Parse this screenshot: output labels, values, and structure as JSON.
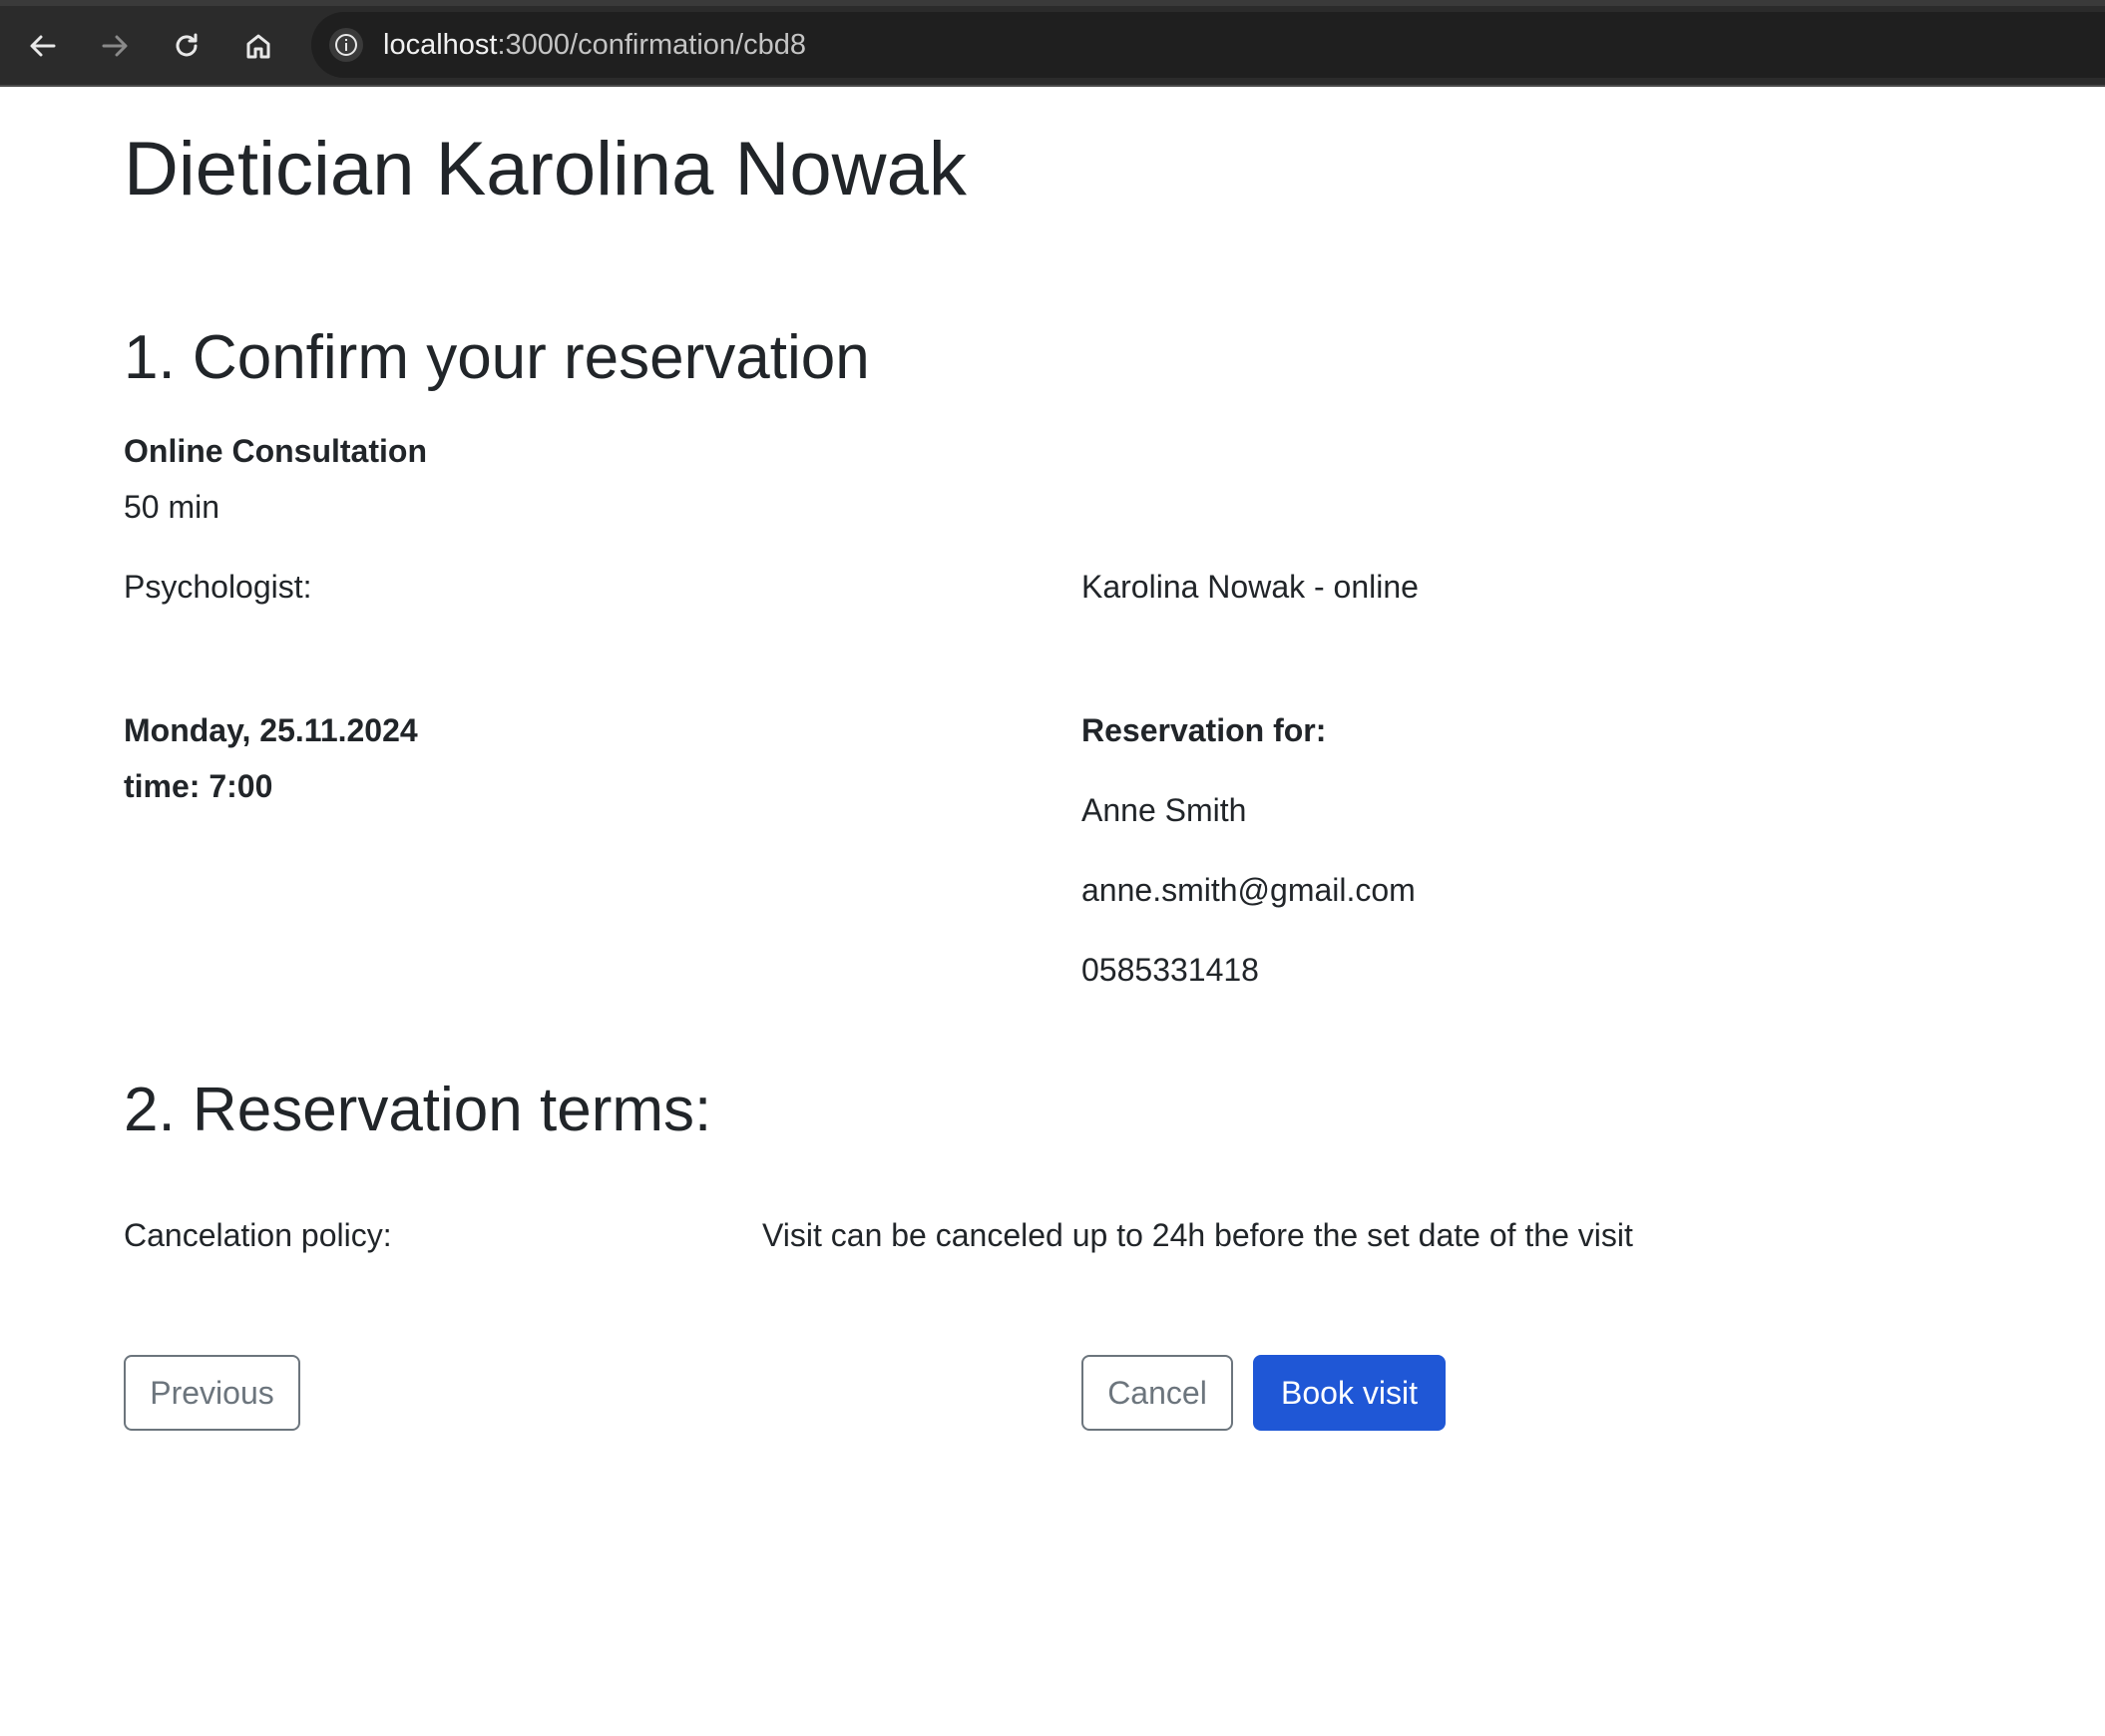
{
  "browser": {
    "url_host": "localhost",
    "url_path": ":3000/confirmation/cbd8",
    "icons": [
      "back-arrow-icon",
      "forward-arrow-icon",
      "reload-icon",
      "home-icon",
      "info-icon"
    ],
    "colors": {
      "toolbar": "#2b2b2b",
      "urlbar": "#1f1f1f"
    }
  },
  "page": {
    "title": "Dietician Karolina Nowak",
    "section1": {
      "heading": "1. Confirm your reservation",
      "service_name": "Online Consultation",
      "duration": "50 min",
      "psychologist_label": "Psychologist:",
      "psychologist_value": "Karolina Nowak - online",
      "date": "Monday, 25.11.2024",
      "time": "time: 7:00",
      "reservation_for_label": "Reservation for:",
      "client_name": "Anne Smith",
      "client_email": "anne.smith@gmail.com",
      "client_phone": "0585331418"
    },
    "section2": {
      "heading": "2. Reservation terms:",
      "policy_label": "Cancelation policy:",
      "policy_value": "Visit can be canceled up to 24h before the set date of the visit"
    },
    "buttons": {
      "previous": "Previous",
      "cancel": "Cancel",
      "book": "Book visit"
    },
    "colors": {
      "primary": "#1f57d6",
      "outline": "#6c757d",
      "text": "#212529"
    }
  }
}
